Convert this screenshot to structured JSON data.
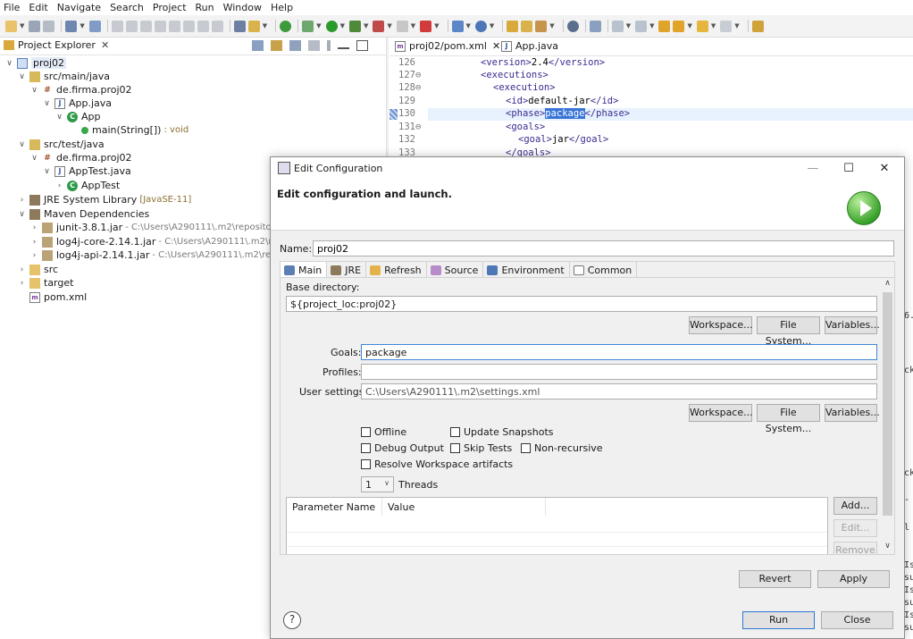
{
  "menu": [
    "File",
    "Edit",
    "Navigate",
    "Search",
    "Project",
    "Run",
    "Window",
    "Help"
  ],
  "project_explorer": {
    "tab_label": "Project Explorer",
    "tree": [
      {
        "label": "proj02",
        "extra": ""
      },
      {
        "label": "src/main/java",
        "extra": ""
      },
      {
        "label": "de.firma.proj02",
        "extra": ""
      },
      {
        "label": "App.java",
        "extra": ""
      },
      {
        "label": "App",
        "extra": ""
      },
      {
        "label": "main(String[])",
        "extra": ": void"
      },
      {
        "label": "src/test/java",
        "extra": ""
      },
      {
        "label": "de.firma.proj02",
        "extra": ""
      },
      {
        "label": "AppTest.java",
        "extra": ""
      },
      {
        "label": "AppTest",
        "extra": ""
      },
      {
        "label": "JRE System Library",
        "extra": "[JavaSE-11]"
      },
      {
        "label": "Maven Dependencies",
        "extra": ""
      },
      {
        "label": "junit-3.8.1.jar",
        "extra": "- C:\\Users\\A290111\\.m2\\repository\\"
      },
      {
        "label": "log4j-core-2.14.1.jar",
        "extra": "- C:\\Users\\A290111\\.m2\\repo"
      },
      {
        "label": "log4j-api-2.14.1.jar",
        "extra": "- C:\\Users\\A290111\\.m2\\repos"
      },
      {
        "label": "src",
        "extra": ""
      },
      {
        "label": "target",
        "extra": ""
      },
      {
        "label": "pom.xml",
        "extra": ""
      }
    ]
  },
  "editor": {
    "tabs": [
      {
        "label": "proj02/pom.xml"
      },
      {
        "label": "App.java"
      }
    ],
    "lines": [
      {
        "num": "126",
        "pre": "<version>",
        "text": "2.4",
        "post": "</version>"
      },
      {
        "num": "127⊖",
        "pre": "<executions>",
        "text": "",
        "post": ""
      },
      {
        "num": "128⊖",
        "pre": "<execution>",
        "text": "",
        "post": ""
      },
      {
        "num": "129",
        "pre": "<id>",
        "text": "default-jar",
        "post": "</id>"
      },
      {
        "num": "130",
        "pre": "<phase>",
        "text": "package",
        "post": "</phase>"
      },
      {
        "num": "131⊖",
        "pre": "<goals>",
        "text": "",
        "post": ""
      },
      {
        "num": "132",
        "pre": "<goal>",
        "text": "jar",
        "post": "</goal>"
      },
      {
        "num": "133",
        "pre": "</goals>",
        "text": "",
        "post": ""
      }
    ],
    "right_fragments": [
      "6.0",
      "ck",
      "ck",
      "-",
      "l",
      "Is",
      "su",
      "Is",
      "su",
      "Is",
      "su"
    ]
  },
  "dialog": {
    "title": "Edit Configuration",
    "heading": "Edit configuration and launch.",
    "name_label": "Name:",
    "name_value": "proj02",
    "tabs": [
      "Main",
      "JRE",
      "Refresh",
      "Source",
      "Environment",
      "Common"
    ],
    "base_directory_label": "Base directory:",
    "base_directory_value": "${project_loc:proj02}",
    "buttons_row1": [
      "Workspace...",
      "File System...",
      "Variables..."
    ],
    "goals_label": "Goals:",
    "goals_value": "package",
    "profiles_label": "Profiles:",
    "profiles_value": "",
    "user_settings_label": "User settings:",
    "user_settings_value": "C:\\Users\\A290111\\.m2\\settings.xml",
    "buttons_row2": [
      "Workspace...",
      "File System...",
      "Variables..."
    ],
    "checkboxes": {
      "offline": "Offline",
      "update_snapshots": "Update Snapshots",
      "debug_output": "Debug Output",
      "skip_tests": "Skip Tests",
      "non_recursive": "Non-recursive",
      "resolve_workspace": "Resolve Workspace artifacts"
    },
    "threads_value": "1",
    "threads_label": "Threads",
    "param_table": {
      "headers": [
        "Parameter Name",
        "Value"
      ]
    },
    "param_buttons": [
      "Add...",
      "Edit...",
      "Remove"
    ],
    "revert_label": "Revert",
    "apply_label": "Apply",
    "run_label": "Run",
    "close_label": "Close",
    "help_icon": "?"
  }
}
